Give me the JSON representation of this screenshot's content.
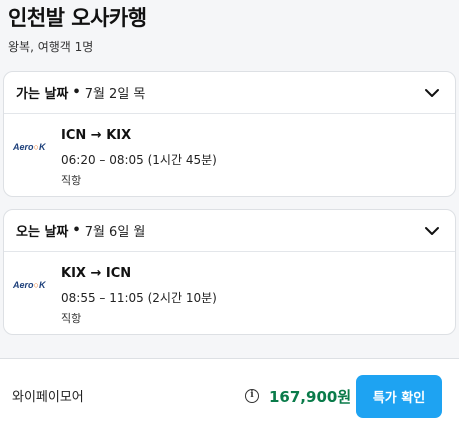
{
  "header": {
    "title": "인천발 오사카행",
    "subtitle": "왕복, 여행객 1명"
  },
  "outbound": {
    "direction_label": "가는 날짜",
    "separator": "•",
    "date": "7월 2일 목",
    "airline_logo": {
      "prefix": "Aero",
      "suffix": "K"
    },
    "route": "ICN → KIX",
    "times": "06:20 – 08:05 (1시간 45분)",
    "stops": "직항"
  },
  "inbound": {
    "direction_label": "오는 날짜",
    "separator": "•",
    "date": "7월 6일 월",
    "airline_logo": {
      "prefix": "Aero",
      "suffix": "K"
    },
    "route": "KIX → ICN",
    "times": "08:55 – 11:05 (2시간 10분)",
    "stops": "직항"
  },
  "footer": {
    "provider": "와이페이모어",
    "info_icon": "info-icon",
    "price": "167,900원",
    "deal_button_label": "특가 확인"
  },
  "colors": {
    "price": "#0a7b4a",
    "button": "#1ea3f2",
    "logo_text": "#1c3f7a",
    "logo_accent": "#e8792d"
  }
}
